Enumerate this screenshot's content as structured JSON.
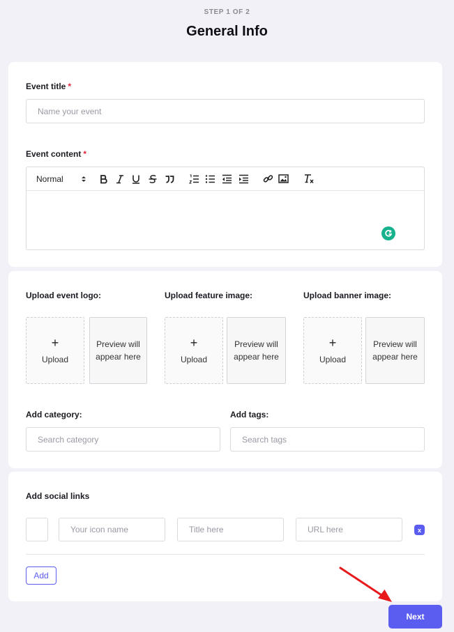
{
  "header": {
    "step": "STEP 1 OF 2",
    "title": "General Info"
  },
  "event_title": {
    "label": "Event title",
    "required_mark": "*",
    "placeholder": "Name your event"
  },
  "event_content": {
    "label": "Event content",
    "required_mark": "*",
    "format_select": "Normal",
    "toolbar_icons": [
      "bold-icon",
      "italic-icon",
      "underline-icon",
      "strikethrough-icon",
      "blockquote-icon",
      "ordered-list-icon",
      "bullet-list-icon",
      "outdent-icon",
      "indent-icon",
      "link-icon",
      "image-icon",
      "clear-format-icon"
    ]
  },
  "uploads": {
    "logo_label": "Upload event logo:",
    "feature_label": "Upload feature image:",
    "banner_label": "Upload banner image:",
    "upload_plus": "+",
    "upload_text": "Upload",
    "preview_text": "Preview will appear here"
  },
  "category": {
    "label": "Add category:",
    "placeholder": "Search category"
  },
  "tags": {
    "label": "Add tags:",
    "placeholder": "Search tags"
  },
  "social": {
    "label": "Add social links",
    "icon_name_placeholder": "Your icon name",
    "title_placeholder": "Title here",
    "url_placeholder": "URL here",
    "remove_label": "x",
    "add_label": "Add"
  },
  "footer": {
    "next_label": "Next"
  },
  "colors": {
    "accent": "#5b5cf0",
    "required": "#e0243b",
    "grammarly": "#16b28e",
    "annotation_arrow": "#e8191b"
  }
}
